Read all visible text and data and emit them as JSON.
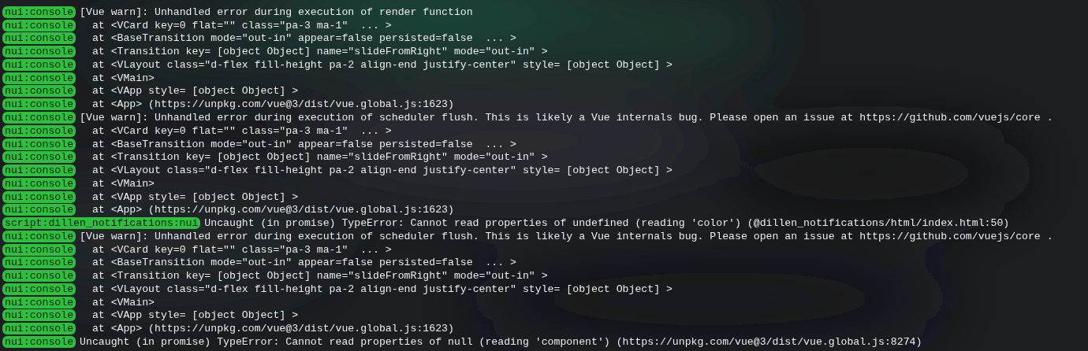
{
  "console_lines": [
    {
      "source": "nui:console",
      "text": "[Vue warn]: Unhandled error during execution of render function"
    },
    {
      "source": "nui:console",
      "text": "  at <VCard key=0 flat=\"\" class=\"pa-3 ma-1\"  ... >"
    },
    {
      "source": "nui:console",
      "text": "  at <BaseTransition mode=\"out-in\" appear=false persisted=false  ... >"
    },
    {
      "source": "nui:console",
      "text": "  at <Transition key= [object Object] name=\"slideFromRight\" mode=\"out-in\" >"
    },
    {
      "source": "nui:console",
      "text": "  at <VLayout class=\"d-flex fill-height pa-2 align-end justify-center\" style= [object Object] >"
    },
    {
      "source": "nui:console",
      "text": "  at <VMain>"
    },
    {
      "source": "nui:console",
      "text": "  at <VApp style= [object Object] >"
    },
    {
      "source": "nui:console",
      "text": "  at <App> (https://unpkg.com/vue@3/dist/vue.global.js:1623)"
    },
    {
      "source": "nui:console",
      "text": "[Vue warn]: Unhandled error during execution of scheduler flush. This is likely a Vue internals bug. Please open an issue at https://github.com/vuejs/core ."
    },
    {
      "source": "nui:console",
      "text": "  at <VCard key=0 flat=\"\" class=\"pa-3 ma-1\"  ... >"
    },
    {
      "source": "nui:console",
      "text": "  at <BaseTransition mode=\"out-in\" appear=false persisted=false  ... >"
    },
    {
      "source": "nui:console",
      "text": "  at <Transition key= [object Object] name=\"slideFromRight\" mode=\"out-in\" >"
    },
    {
      "source": "nui:console",
      "text": "  at <VLayout class=\"d-flex fill-height pa-2 align-end justify-center\" style= [object Object] >"
    },
    {
      "source": "nui:console",
      "text": "  at <VMain>"
    },
    {
      "source": "nui:console",
      "text": "  at <VApp style= [object Object] >"
    },
    {
      "source": "nui:console",
      "text": "  at <App> (https://unpkg.com/vue@3/dist/vue.global.js:1623)"
    },
    {
      "source": "script:dillen_notifications:nui",
      "text": "Uncaught (in promise) TypeError: Cannot read properties of undefined (reading 'color') (@dillen_notifications/html/index.html:50)"
    },
    {
      "source": "nui:console",
      "text": "[Vue warn]: Unhandled error during execution of scheduler flush. This is likely a Vue internals bug. Please open an issue at https://github.com/vuejs/core ."
    },
    {
      "source": "nui:console",
      "text": "  at <VCard key=0 flat=\"\" class=\"pa-3 ma-1\"  ... >"
    },
    {
      "source": "nui:console",
      "text": "  at <BaseTransition mode=\"out-in\" appear=false persisted=false  ... >"
    },
    {
      "source": "nui:console",
      "text": "  at <Transition key= [object Object] name=\"slideFromRight\" mode=\"out-in\" >"
    },
    {
      "source": "nui:console",
      "text": "  at <VLayout class=\"d-flex fill-height pa-2 align-end justify-center\" style= [object Object] >"
    },
    {
      "source": "nui:console",
      "text": "  at <VMain>"
    },
    {
      "source": "nui:console",
      "text": "  at <VApp style= [object Object] >"
    },
    {
      "source": "nui:console",
      "text": "  at <App> (https://unpkg.com/vue@3/dist/vue.global.js:1623)"
    },
    {
      "source": "nui:console",
      "text": "Uncaught (in promise) TypeError: Cannot read properties of null (reading 'component') (https://unpkg.com/vue@3/dist/vue.global.js:8274)"
    }
  ]
}
